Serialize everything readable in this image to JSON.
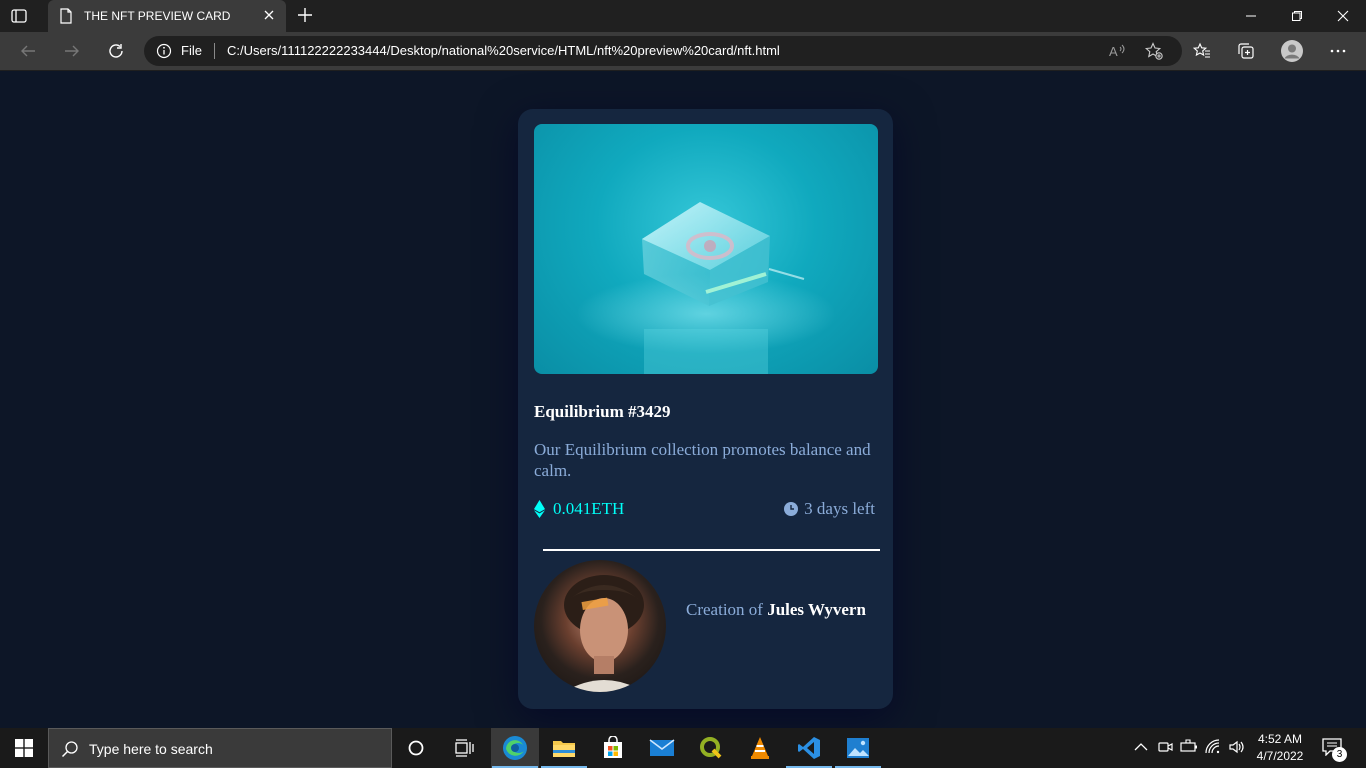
{
  "browser": {
    "tab_title": "THE NFT PREVIEW CARD",
    "address_scheme": "File",
    "address_url": "C:/Users/111122222233444/Desktop/national%20service/HTML/nft%20preview%20card/nft.html"
  },
  "card": {
    "title": "Equilibrium #3429",
    "description": "Our Equilibrium collection promotes balance and calm.",
    "price": "0.041ETH",
    "time_left": "3 days left",
    "creator_prefix": "Creation of",
    "creator_name": "Jules Wyvern"
  },
  "taskbar": {
    "search_placeholder": "Type here to search",
    "time": "4:52 AM",
    "date": "4/7/2022",
    "notification_count": "3"
  },
  "colors": {
    "page_bg": "#0d1627",
    "card_bg": "#15263f",
    "accent_cyan": "#00fff8",
    "soft_blue": "#8bacd9"
  }
}
